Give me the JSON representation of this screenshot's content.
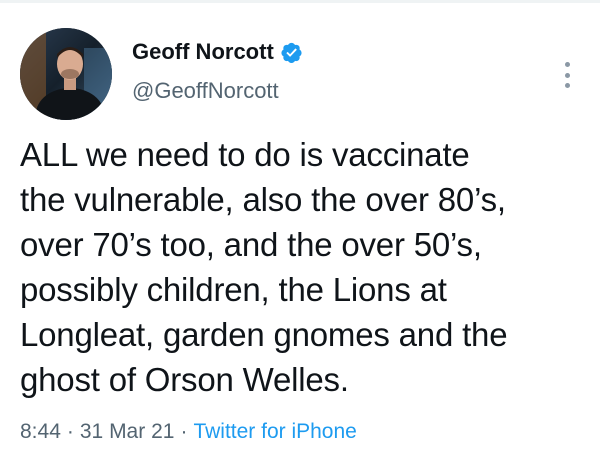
{
  "tweet": {
    "author": {
      "display_name": "Geoff Norcott",
      "handle": "@GeoffNorcott",
      "verified": true,
      "avatar_icon": "user-avatar-photo"
    },
    "text": "ALL we need to do is vaccinate\nthe vulnerable, also the over 80’s,\nover 70’s too, and the over 50’s,\npossibly children, the Lions at\nLongleat, garden gnomes and the\nghost of Orson Welles.",
    "time": "8:44",
    "date": "31 Mar 21",
    "separator": "·",
    "source": "Twitter for iPhone"
  },
  "icons": {
    "verified": "verified-badge-icon",
    "more": "more-vertical-icon"
  },
  "colors": {
    "text": "#0f1419",
    "secondary": "#536471",
    "accent": "#1d9bf0"
  }
}
